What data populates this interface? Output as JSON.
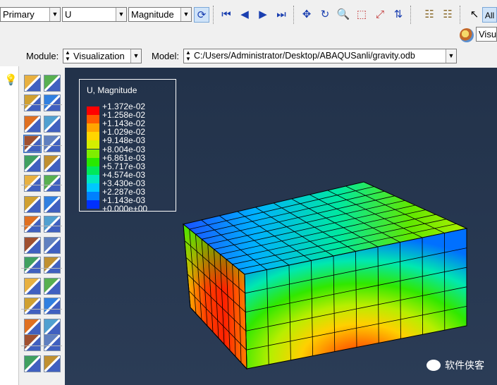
{
  "toolbar": {
    "combo_primary": "Primary",
    "combo_variable": "U",
    "combo_invariant": "Magnitude",
    "all_label": "All"
  },
  "row2": {
    "visualization_short": "Visu"
  },
  "context": {
    "module_label": "Module:",
    "module_value": "Visualization",
    "model_label": "Model:",
    "model_path": "C:/Users/Administrator/Desktop/ABAQUSanli/gravity.odb"
  },
  "legend": {
    "title": "U, Magnitude",
    "entries": [
      {
        "value": "+1.372e-02",
        "color": "#ff0000"
      },
      {
        "value": "+1.258e-02",
        "color": "#ff5a00"
      },
      {
        "value": "+1.143e-02",
        "color": "#ffa500"
      },
      {
        "value": "+1.029e-02",
        "color": "#ffd500"
      },
      {
        "value": "+9.148e-03",
        "color": "#d4ee00"
      },
      {
        "value": "+8.004e-03",
        "color": "#7fee00"
      },
      {
        "value": "+6.861e-03",
        "color": "#28e800"
      },
      {
        "value": "+5.717e-03",
        "color": "#00e85a"
      },
      {
        "value": "+4.574e-03",
        "color": "#00e8c0"
      },
      {
        "value": "+3.430e-03",
        "color": "#00c8ff"
      },
      {
        "value": "+2.287e-03",
        "color": "#0080ff"
      },
      {
        "value": "+1.143e-03",
        "color": "#0030ff"
      }
    ],
    "min_label": "+0.000e+00"
  },
  "watermark": "软件侠客",
  "colors": {
    "viewport_bg": "#26364f",
    "accent_blue": "#1a3fb0"
  }
}
